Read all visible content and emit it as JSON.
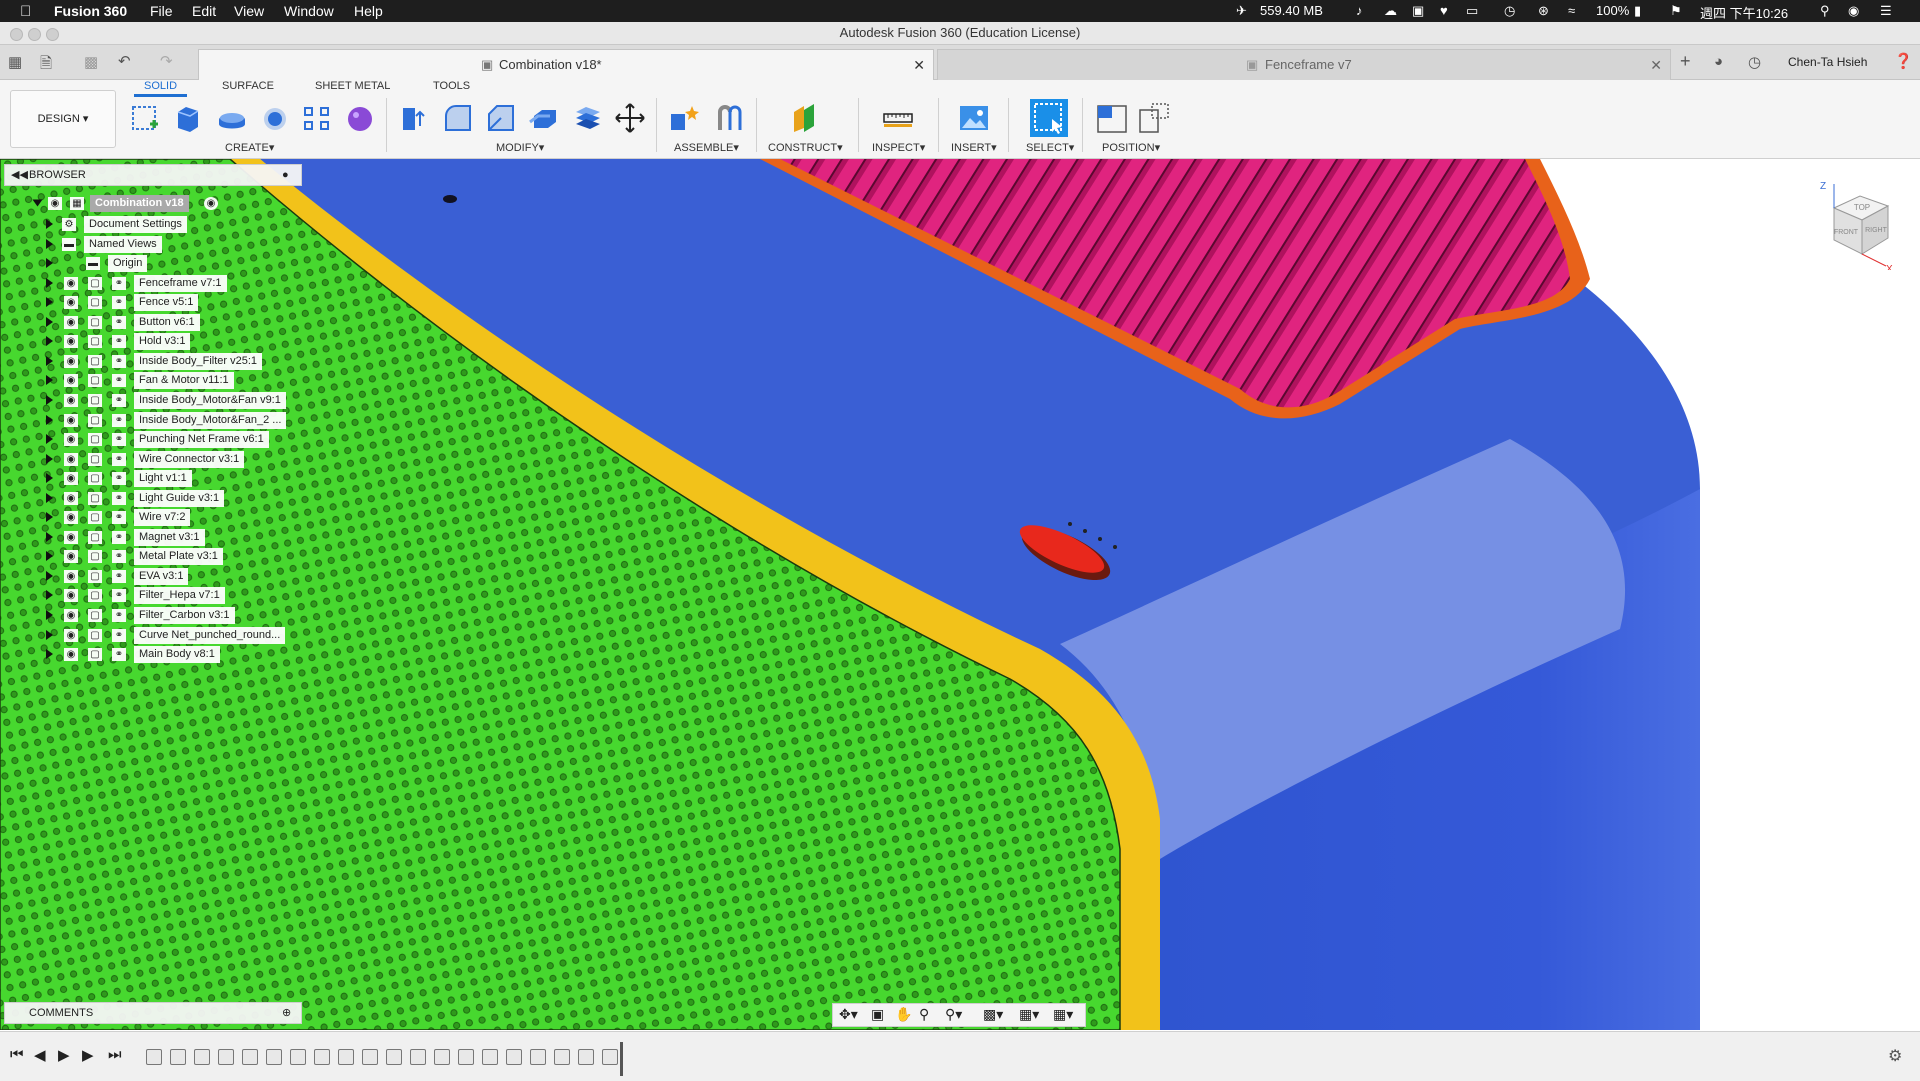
{
  "menubar": {
    "app_name": "Fusion 360",
    "items": [
      "File",
      "Edit",
      "View",
      "Window",
      "Help"
    ],
    "memory": "559.40 MB",
    "battery": "100%",
    "clock": "週四 下午10:26"
  },
  "window": {
    "title": "Autodesk Fusion 360 (Education License)"
  },
  "tabs": [
    {
      "label": "Combination v18*",
      "active": true
    },
    {
      "label": "Fenceframe v7",
      "active": false
    }
  ],
  "user": "Chen-Ta Hsieh",
  "toolbar": {
    "workspace": "DESIGN",
    "workspace_tabs": [
      "SOLID",
      "SURFACE",
      "SHEET METAL",
      "TOOLS"
    ],
    "groups": [
      "CREATE",
      "MODIFY",
      "ASSEMBLE",
      "CONSTRUCT",
      "INSPECT",
      "INSERT",
      "SELECT",
      "POSITION"
    ]
  },
  "browser": {
    "title": "BROWSER",
    "root": "Combination v18",
    "items": [
      "Document Settings",
      "Named Views",
      "Origin",
      "Fenceframe v7:1",
      "Fence v5:1",
      "Button v6:1",
      "Hold v3:1",
      "Inside Body_Filter v25:1",
      "Fan & Motor v11:1",
      "Inside Body_Motor&Fan v9:1",
      "Inside Body_Motor&Fan_2 ...",
      "Punching Net Frame v6:1",
      "Wire Connector v3:1",
      "Light v1:1",
      "Light Guide v3:1",
      "Wire v7:2",
      "Magnet v3:1",
      "Metal Plate v3:1",
      "EVA v3:1",
      "Filter_Hepa v7:1",
      "Filter_Carbon v3:1",
      "Curve Net_punched_round...",
      "Main Body v8:1"
    ]
  },
  "comments": {
    "title": "COMMENTS"
  },
  "viewcube": {
    "top": "TOP",
    "front": "FRONT",
    "right": "RIGHT",
    "x": "X",
    "z": "Z"
  },
  "colors": {
    "body_blue": "#3a5fd4",
    "mesh_green": "#45d62e",
    "frame_yellow": "#f2c21a",
    "grille_magenta": "#d41c7a",
    "button_red": "#e8281c",
    "accent": "#1f6fd1"
  }
}
